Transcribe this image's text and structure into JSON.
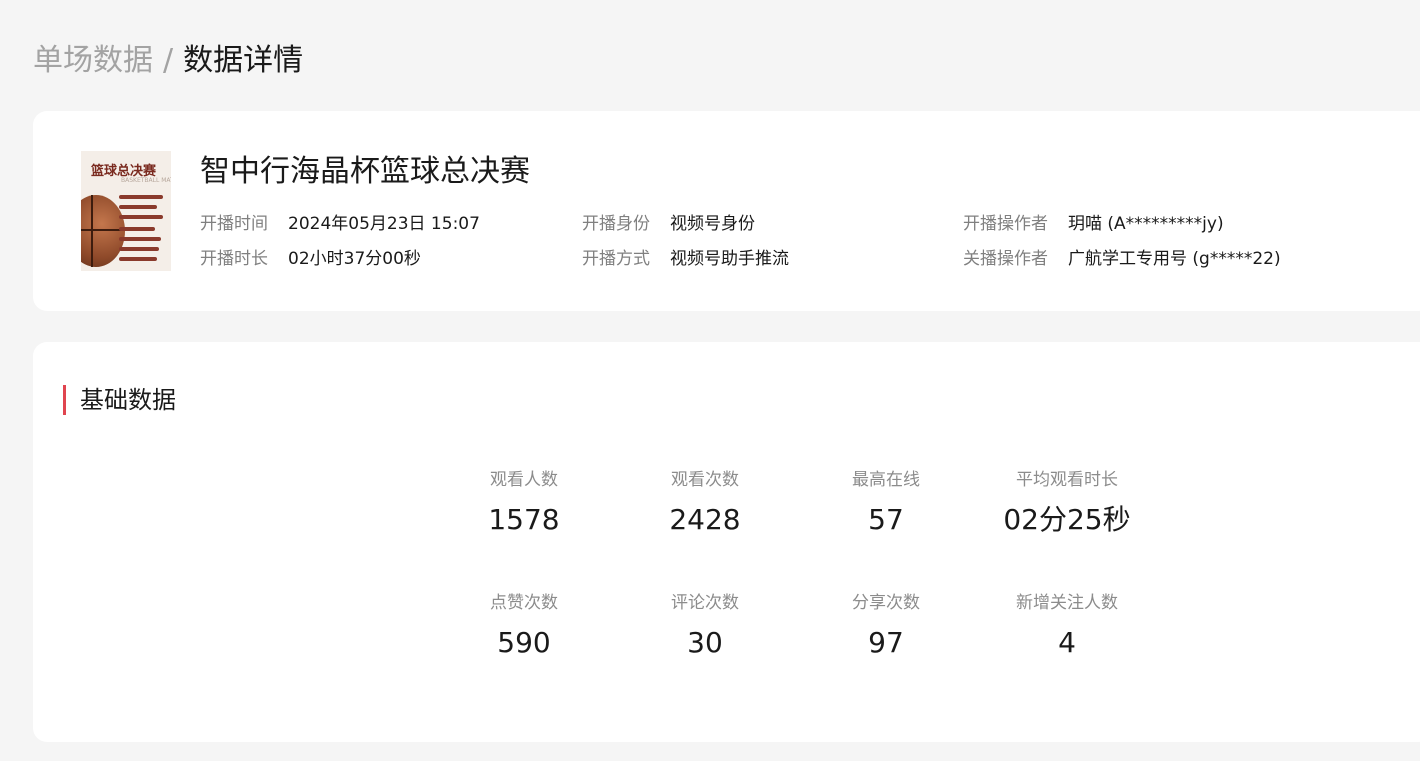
{
  "breadcrumb": {
    "parent": "单场数据",
    "separator": "/",
    "current": "数据详情"
  },
  "match": {
    "cover": {
      "title": "篮球总决赛",
      "subtitle": "BASKETBALL MATCH"
    },
    "title": "智中行海晶杯篮球总决赛",
    "meta": {
      "start_time_label": "开播时间",
      "start_time": "2024年05月23日 15:07",
      "duration_label": "开播时长",
      "duration": "02小时37分00秒",
      "identity_label": "开播身份",
      "identity": "视频号身份",
      "method_label": "开播方式",
      "method": "视频号助手推流",
      "start_operator_label": "开播操作者",
      "start_operator": "玥喵 (A*********jy)",
      "stop_operator_label": "关播操作者",
      "stop_operator": "广航学工专用号 (g*****22)"
    }
  },
  "basic_data": {
    "title": "基础数据",
    "stats": [
      {
        "label": "观看人数",
        "value": "1578"
      },
      {
        "label": "观看次数",
        "value": "2428"
      },
      {
        "label": "最高在线",
        "value": "57"
      },
      {
        "label": "平均观看时长",
        "value": "02分25秒"
      },
      {
        "label": "点赞次数",
        "value": "590"
      },
      {
        "label": "评论次数",
        "value": "30"
      },
      {
        "label": "分享次数",
        "value": "97"
      },
      {
        "label": "新增关注人数",
        "value": "4"
      }
    ]
  },
  "colors": {
    "accent": "#e0454f",
    "background": "#f5f5f5",
    "card": "#ffffff"
  }
}
